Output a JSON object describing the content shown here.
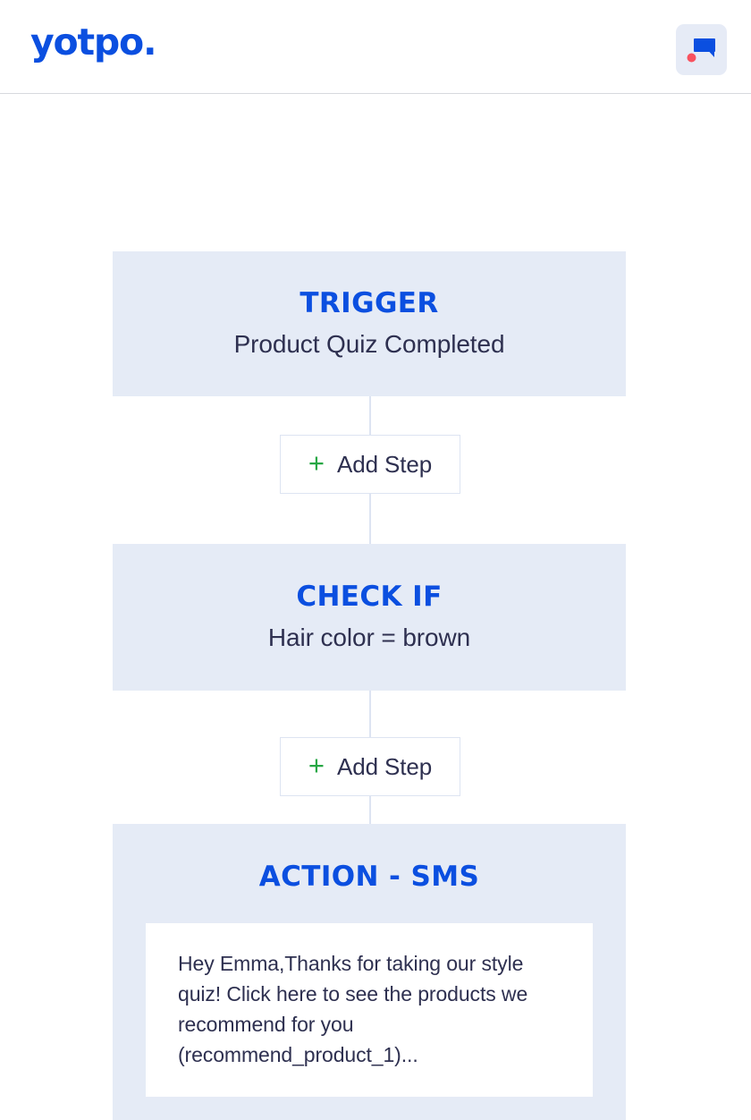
{
  "header": {
    "logo_text": "yotpo.",
    "logo_color": "#0b4fe0",
    "chat_button": {
      "icon": "chat-bubble-icon",
      "badge_icon": "notification-dot-icon",
      "bubble_color": "#0b4fe0",
      "badge_color": "#f8525f",
      "background_color": "#e6ebf6"
    }
  },
  "flow": {
    "card_background": "#e5ebf6",
    "accent_color": "#0b4fe0",
    "text_color": "#2e3050",
    "connector_color": "#dde4f2",
    "steps": [
      {
        "type": "trigger",
        "kicker": "TRIGGER",
        "subtitle": "Product Quiz Completed"
      },
      {
        "type": "condition",
        "kicker": "CHECK IF",
        "subtitle": "Hair color = brown"
      },
      {
        "type": "action",
        "kicker": "ACTION - SMS",
        "message": "Hey Emma,Thanks for taking our style quiz! Click here to see the products we recommend for you (recommend_product_1)..."
      }
    ],
    "add_step": {
      "label": "Add Step",
      "plus_glyph": "+",
      "plus_color": "#27a744"
    }
  }
}
